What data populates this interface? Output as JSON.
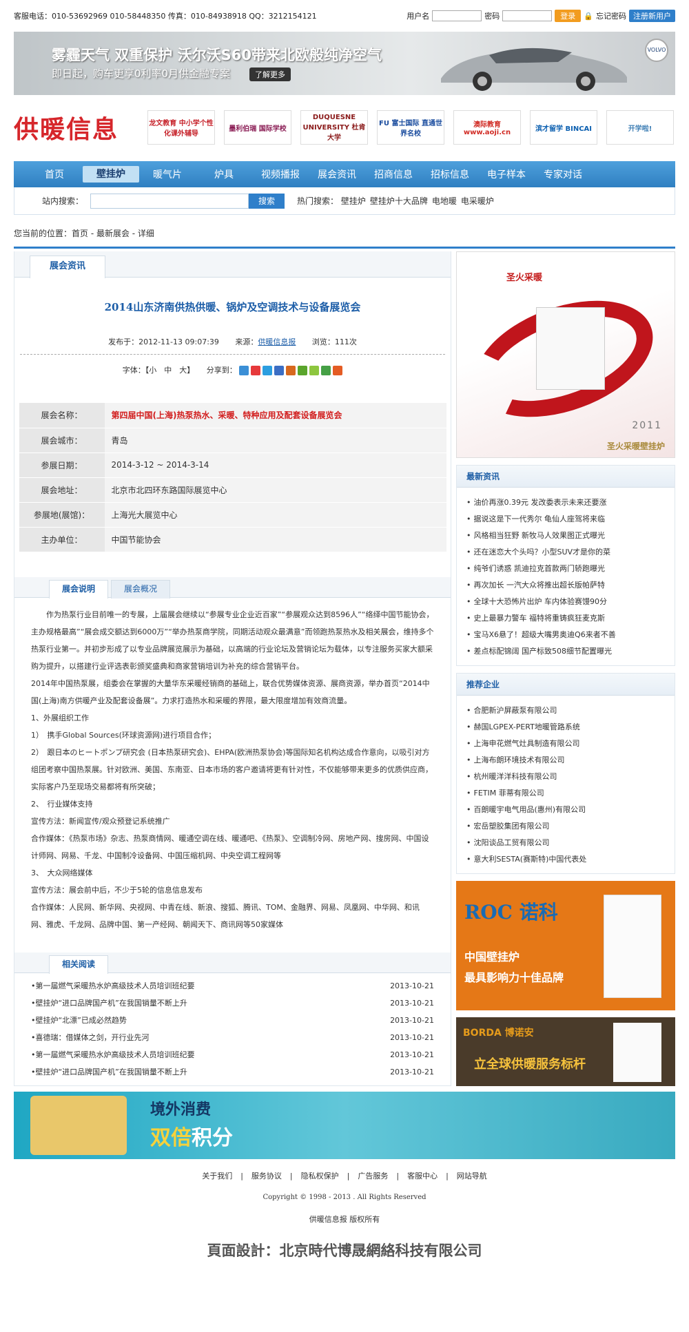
{
  "topbar": {
    "contact": "客服电话：010-53692969 010-58448350 传真：010-84938918 QQ：3212154121",
    "username_label": "用户名",
    "password_label": "密码",
    "login_button": "登录",
    "forgot": "忘记密码",
    "register": "注册新用户"
  },
  "banner": {
    "line1": "雾霾天气 双重保护 沃尔沃S60带来北欧般纯净空气",
    "line2": "即日起，购车更享0利率0月供金融专案",
    "more": "了解更多",
    "brand": "VOLVO"
  },
  "site": {
    "logo": "供暖信息"
  },
  "ads": [
    {
      "text": "龙文教育 中小学个性化课外辅导",
      "color": "#c62129"
    },
    {
      "text": "墨利伯瑞 国际学校",
      "color": "#8a1c54"
    },
    {
      "text": "DUQUESNE UNIVERSITY 杜肯大学",
      "color": "#8b1b1b"
    },
    {
      "text": "FU 富士国际 直通世界名校",
      "color": "#1a4c9e"
    },
    {
      "text": "澳际教育 www.aoji.cn",
      "color": "#d12b24"
    },
    {
      "text": "滨才留学 BINCAI",
      "color": "#0b5fb0"
    },
    {
      "text": "开学啦!",
      "color": "#3f7fb5"
    }
  ],
  "nav": [
    "首页",
    "壁挂炉",
    "暖气片",
    "炉具",
    "视频播报",
    "展会资讯",
    "招商信息",
    "招标信息",
    "电子样本",
    "专家对话"
  ],
  "search": {
    "label": "站内搜索：",
    "button": "搜索",
    "hot_label": "热门搜索：",
    "hot": [
      "壁挂炉",
      "壁挂炉十大品牌",
      "电地暖",
      "电采暖炉"
    ]
  },
  "crumb": "您当前的位置：首页 - 最新展会 - 详细",
  "article": {
    "tab": "展会资讯",
    "title": "2014山东济南供热供暖、锅炉及空调技术与设备展览会",
    "publish": "发布于：2012-11-13 09:07:39",
    "source_label": "来源：",
    "source": "供暖信息报",
    "views": "浏览：111次",
    "font": "字体：【小　中　大】",
    "share": "分享到：",
    "share_colors": [
      "#3b8fd6",
      "#e6393b",
      "#2c9ee0",
      "#3b6ec4",
      "#d7681e",
      "#5aa52c",
      "#8dc63f",
      "#46a046",
      "#e45c24"
    ]
  },
  "info": [
    {
      "k": "展会名称：",
      "v": "第四届中国(上海)热泵热水、采暖、特种应用及配套设备展览会",
      "red": true
    },
    {
      "k": "展会城市：",
      "v": "青岛"
    },
    {
      "k": "参展日期：",
      "v": "2014-3-12 ~ 2014-3-14"
    },
    {
      "k": "展会地址：",
      "v": "北京市北四环东路国际展览中心"
    },
    {
      "k": "参展地(展馆)：",
      "v": "上海光大展览中心"
    },
    {
      "k": "主办单位：",
      "v": "中国节能协会"
    }
  ],
  "subtabs": [
    "展会说明",
    "展会概况"
  ],
  "body": [
    "　　作为热泵行业目前唯一的专展，上届展会继续以“参展专业企业近百家”“参展观众达到8596人”“络绎中国节能协会，主办规格最高”“展会成交额达到6000万”“举办热泵商学院，同期活动观众最满意”而领跑热泵热水及相关展会，维持多个热泵行业第一。并初步形成了以专业品牌展览展示为基础，以高端的行业论坛及营销论坛为载体，以专注服务买家大额采购为提升，以搭建行业评选表彰颁奖盛典和商家营销培训为补充的综合营销平台。",
    "2014年中国热泵展，组委会在掌握的大量华东采暖经销商的基础上，联合优势媒体资源、展商资源，举办首页“2014中国(上海)南方供暖产业及配套设备展”。力求打造热水和采暖的界限，最大限度增加有效商流量。",
    "1、外展组织工作",
    "1）　携手Global Sources(环球资源网)进行项目合作；",
    "2）　跟日本のヒートポンプ研究会 (日本热泵研究会)、EHPA(欧洲热泵协会)等国际知名机构达成合作意向，以吸引对方组团考察中国热泵展。针对欧洲、美国、东南亚、日本市场的客户邀请将更有针对性，不仅能够带来更多的优质供应商，实际客户乃至现场交易都将有所突破；",
    "2、　行业媒体支持",
    "宣传方法：新闻宣传/观众预登记系统推广",
    "合作媒体：《热泵市场》杂志、热泵商情网、暖通空调在线、暖通吧、《热泵》、空调制冷网、房地产网、搜房网、中国设计师网、网易、千龙、中国制冷设备网、中国压缩机网、中央空调工程网等",
    "3、　大众网络媒体",
    "宣传方法：展会前中后，不少于5轮的信息信息发布",
    "合作媒体：人民网、新华网、央视网、中青在线、新浪、搜狐、腾讯、TOM、金融界、网易、凤凰网、中华网、和讯网、雅虎、千龙网、品牌中国、第一产经网、朝闻天下、商讯网等50家媒体"
  ],
  "related": {
    "tab": "相关阅读",
    "items": [
      {
        "t": "第一届燃气采暖热水炉高级技术人员培训班纪要",
        "d": "2013-10-21"
      },
      {
        "t": "壁挂炉“进口品牌国产机”在我国销量不断上升",
        "d": "2013-10-21"
      },
      {
        "t": "壁挂炉“北漂”已成必然趋势",
        "d": "2013-10-21"
      },
      {
        "t": "喜德瑞：借媒体之剑，开行业先河",
        "d": "2013-10-21"
      },
      {
        "t": "第一届燃气采暖热水炉高级技术人员培训班纪要",
        "d": "2013-10-21"
      },
      {
        "t": "壁挂炉“进口品牌国产机”在我国销量不断上升",
        "d": "2013-10-21"
      }
    ]
  },
  "right": {
    "ad_brand": "圣火采暖",
    "ad_year": "2011",
    "ad_caption": "圣火采暖壁挂炉",
    "news_title": "最新资讯",
    "news": [
      "油价再涨0.39元 发改委表示未来还要涨",
      "据说这是下一代秀尔 龟仙人座驾将来临",
      "风格相当狂野 新牧马人效果图正式曝光",
      "还在迷恋大个头吗？小型SUV才是你的菜",
      "纯爷们诱惑 凯迪拉克首款两门轿跑曝光",
      "再次加长 一汽大众将推出超长版帕萨特",
      "全球十大恐怖片出炉 车内体验赛馒90分",
      "史上最暴力警车 福特将重铸疯狂麦克斯",
      "宝马X6悬了！超级大嘴男奥迪Q6来者不善",
      "差点标配锦阔 国产标致508细节配置曝光"
    ],
    "rec_title": "推荐企业",
    "rec": [
      "合肥新沪屏蔽泵有限公司",
      "赫国LGPEX-PERT地暖管路系统",
      "上海申花燃气灶具制造有限公司",
      "上海布朗环境技术有限公司",
      "杭州暖洋洋科技有限公司",
      "FETIM 菲蒂有限公司",
      "百朗暖宇电气用品(惠州)有限公司",
      "宏岳塑胶集团有限公司",
      "沈阳谈品工贸有限公司",
      "意大利SESTA(赛斯特)中国代表处"
    ],
    "roc_logo": "ROC 诺科",
    "roc_text1": "中国壁挂炉",
    "roc_text2": "最具影响力十佳品牌",
    "borda_logo": "BORDA 博诺安",
    "borda_text": "立全球供暖服务标杆"
  },
  "bottom_banner": {
    "line1": "境外消费",
    "line2a": "双倍",
    "line2b": "积分"
  },
  "footer": {
    "links": [
      "关于我们",
      "服务协议",
      "隐私权保护",
      "广告服务",
      "客服中心",
      "网站导航"
    ],
    "copyright": "Copyright © 1998 - 2013 . All Rights Reserved",
    "owner": "供暖信息报 版权所有",
    "design": "頁面設計：北京時代博晟網絡科技有限公司"
  }
}
